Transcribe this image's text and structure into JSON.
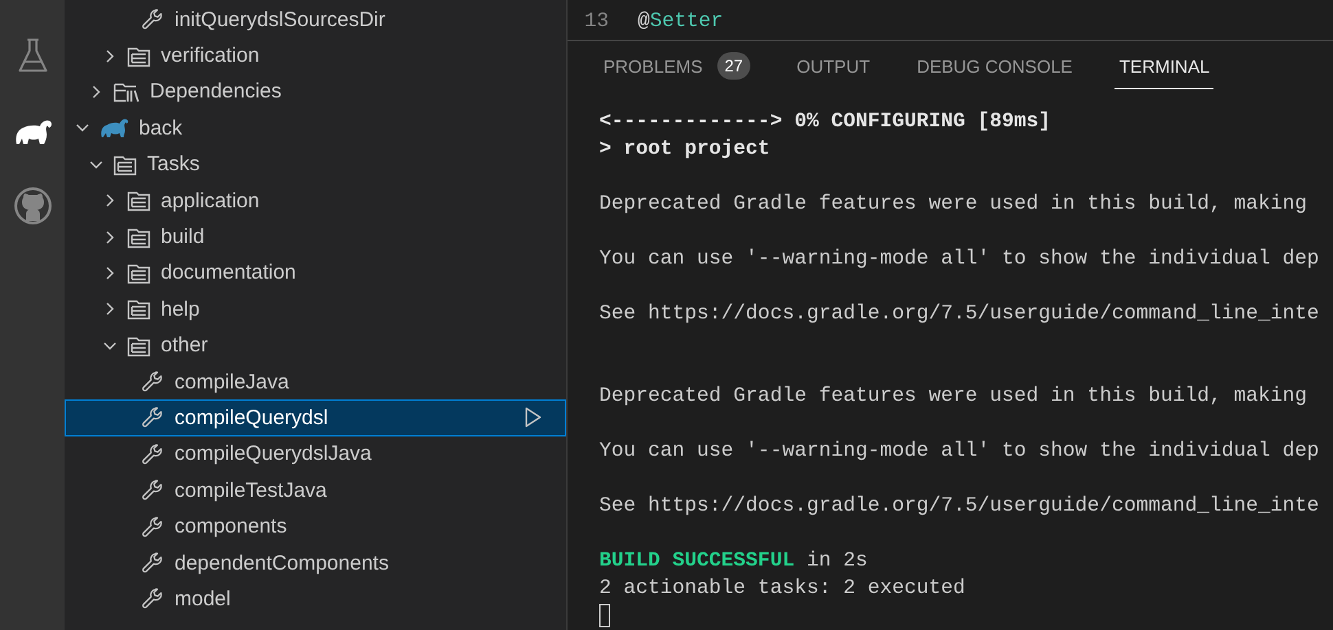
{
  "activity_bar": [
    {
      "kind": "testing",
      "selected": false
    },
    {
      "kind": "gradle",
      "selected": true
    },
    {
      "kind": "github",
      "selected": false
    }
  ],
  "tree": [
    {
      "children": [
        {
          "children": [
            {
              "children": [
                {
                  "kind": "task",
                  "label": "initQuerydslSourcesDir",
                  "selected": false
                }
              ]
            },
            {
              "kind": "group",
              "label": "verification",
              "expanded": false,
              "selected": false
            }
          ]
        },
        {
          "kind": "dependencies",
          "label": "Dependencies",
          "expanded": false,
          "selected": false
        }
      ]
    },
    {
      "kind": "project",
      "label": "back",
      "expanded": true,
      "selected": false,
      "children": [
        {
          "kind": "group",
          "label": "Tasks",
          "expanded": true,
          "selected": false,
          "children": [
            {
              "kind": "group",
              "label": "application",
              "expanded": false,
              "selected": false
            },
            {
              "kind": "group",
              "label": "build",
              "expanded": false,
              "selected": false
            },
            {
              "kind": "group",
              "label": "documentation",
              "expanded": false,
              "selected": false
            },
            {
              "kind": "group",
              "label": "help",
              "expanded": false,
              "selected": false
            },
            {
              "kind": "group",
              "label": "other",
              "expanded": true,
              "selected": false,
              "children": [
                {
                  "kind": "task",
                  "label": "compileJava",
                  "selected": false
                },
                {
                  "kind": "task",
                  "label": "compileQuerydsl",
                  "selected": true
                },
                {
                  "kind": "task",
                  "label": "compileQuerydslJava",
                  "selected": false
                },
                {
                  "kind": "task",
                  "label": "compileTestJava",
                  "selected": false
                },
                {
                  "kind": "task",
                  "label": "components",
                  "selected": false
                },
                {
                  "kind": "task",
                  "label": "dependentComponents",
                  "selected": false
                },
                {
                  "kind": "task",
                  "label": "model",
                  "selected": false
                }
              ]
            }
          ]
        }
      ]
    }
  ],
  "editor": {
    "lines": [
      {
        "number": "13",
        "symbol": "@",
        "name": "Setter"
      }
    ]
  },
  "panel_tabs": [
    {
      "label": "PROBLEMS",
      "badge": "27",
      "selected": false
    },
    {
      "label": "OUTPUT",
      "selected": false
    },
    {
      "label": "DEBUG CONSOLE",
      "selected": false
    },
    {
      "label": "TERMINAL",
      "selected": true
    }
  ],
  "terminal": [
    {
      "kind": "bold",
      "text": "<-------------> 0% CONFIGURING [89ms]"
    },
    {
      "kind": "bold",
      "text": "> root project"
    },
    {
      "kind": "blank"
    },
    {
      "kind": "plain",
      "text": "Deprecated Gradle features were used in this build, making"
    },
    {
      "kind": "blank"
    },
    {
      "kind": "plain",
      "text": "You can use '--warning-mode all' to show the individual dep"
    },
    {
      "kind": "blank"
    },
    {
      "kind": "plain",
      "text": "See https://docs.gradle.org/7.5/userguide/command_line_inte"
    },
    {
      "kind": "blank"
    },
    {
      "kind": "blank"
    },
    {
      "kind": "plain",
      "text": "Deprecated Gradle features were used in this build, making"
    },
    {
      "kind": "blank"
    },
    {
      "kind": "plain",
      "text": "You can use '--warning-mode all' to show the individual dep"
    },
    {
      "kind": "blank"
    },
    {
      "kind": "plain",
      "text": "See https://docs.gradle.org/7.5/userguide/command_line_inte"
    },
    {
      "kind": "blank"
    },
    {
      "kind": "success",
      "status": "BUILD SUCCESSFUL",
      "text": " in 2s"
    },
    {
      "kind": "plain",
      "text": "2 actionable tasks: 2 executed"
    },
    {
      "kind": "cursor"
    }
  ]
}
